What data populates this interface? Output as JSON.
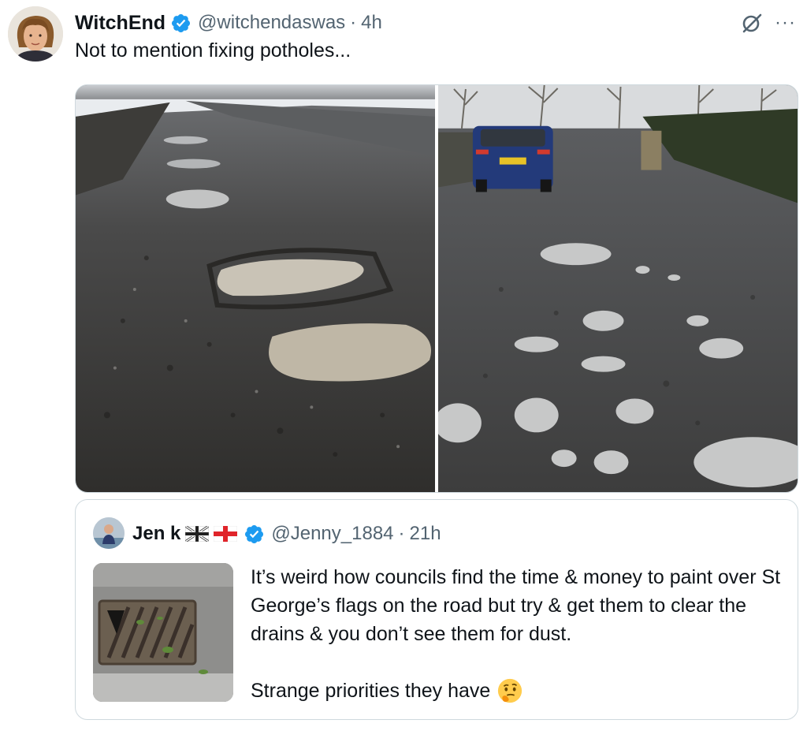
{
  "post": {
    "display_name": "WitchEnd",
    "handle": "@witchendaswas",
    "separator": "·",
    "time": "4h",
    "text": "Not to mention fixing potholes...",
    "icons": {
      "verified": "verified-badge-icon",
      "grok": "grok-icon",
      "more": "more-options-icon",
      "more_glyph": "···"
    },
    "media": [
      {
        "name": "pothole-road-closeup-photo"
      },
      {
        "name": "pothole-lane-with-car-photo"
      }
    ]
  },
  "quote": {
    "display_name": "Jen k",
    "flags": [
      "uk-flag-icon",
      "england-flag-icon"
    ],
    "handle": "@Jenny_1884",
    "separator": "·",
    "time": "21h",
    "text_p1": "It’s weird how councils find the time & money to paint over St George’s flags on the road but try & get them to clear the drains & you don’t see them for dust.",
    "text_p2": "Strange priorities they have",
    "emoji": "thinking-face-icon",
    "thumbnail": "drain-grate-photo"
  },
  "colors": {
    "text": "#0f1419",
    "secondary": "#536471",
    "verified": "#1d9bf0",
    "border": "#cfd9de"
  }
}
